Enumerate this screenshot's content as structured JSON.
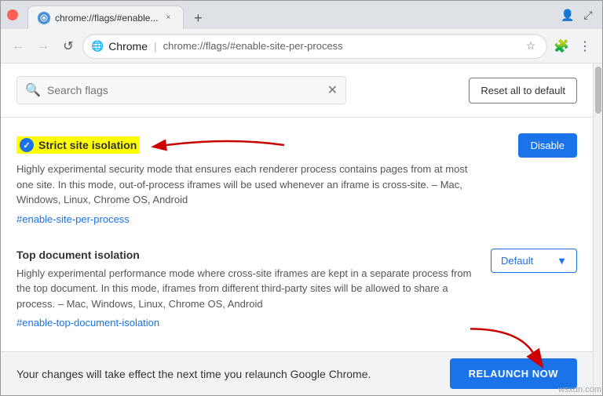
{
  "window": {
    "title": "chrome://flags/#enable-site-per-process"
  },
  "titlebar": {
    "tab_label": "chrome://flags/#enable...",
    "tab_icon": "chrome-icon",
    "close_label": "×",
    "new_tab_label": "+"
  },
  "navbar": {
    "back_label": "←",
    "forward_label": "→",
    "refresh_label": "↺",
    "origin": "Chrome",
    "divider": "|",
    "path": "chrome://flags/#enable-site-per-process",
    "star_label": "☆",
    "extensions_label": "🧩",
    "menu_label": "⋮"
  },
  "flags_page": {
    "search_placeholder": "Search flags",
    "search_value": "",
    "search_clear": "✕",
    "reset_button": "Reset all to default",
    "flag1": {
      "title": "Strict site isolation",
      "description": "Highly experimental security mode that ensures each renderer process contains pages from at most one site. In this mode, out-of-process iframes will be used whenever an iframe is cross-site.  – Mac, Windows, Linux, Chrome OS, Android",
      "link": "#enable-site-per-process",
      "button_label": "Disable"
    },
    "flag2": {
      "title": "Top document isolation",
      "description": "Highly experimental performance mode where cross-site iframes are kept in a separate process from the top document. In this mode, iframes from different third-party sites will be allowed to share a process.  – Mac, Windows, Linux, Chrome OS, Android",
      "link": "#enable-top-document-isolation",
      "select_label": "Default",
      "select_arrow": "▼"
    },
    "bottom_text": "Your changes will take effect the next time you relaunch Google Chrome.",
    "relaunch_button": "RELAUNCH NOW"
  },
  "colors": {
    "blue": "#1a73e8",
    "highlight_yellow": "#ffff00",
    "red_arrow": "#cc0000"
  },
  "watermark": "wsxdn.com"
}
